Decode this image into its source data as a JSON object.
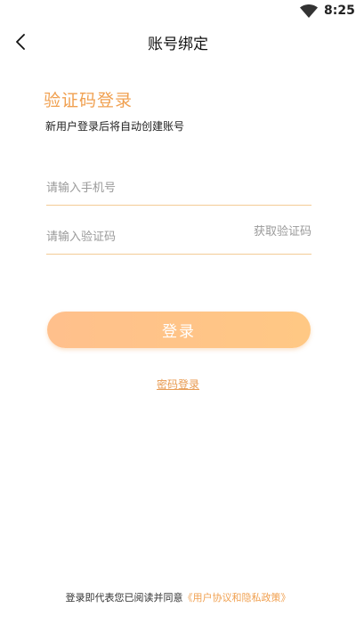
{
  "status_bar": {
    "time": "8:25",
    "wifi_icon": "wifi-icon"
  },
  "nav": {
    "title": "账号绑定",
    "back_icon": "chevron-left-icon"
  },
  "login": {
    "heading": "验证码登录",
    "subtitle": "新用户登录后将自动创建账号",
    "phone": {
      "value": "",
      "placeholder": "请输入手机号"
    },
    "code": {
      "value": "",
      "placeholder": "请输入验证码",
      "get_code_label": "获取验证码"
    },
    "submit_label": "登录",
    "password_login_label": "密码登录"
  },
  "agreement": {
    "prefix": "登录即代表您已阅读并同意",
    "link_label": "《用户协议和隐私政策》"
  },
  "colors": {
    "accent": "#F0A050",
    "button_start": "#FFC08C",
    "button_end": "#FFC884",
    "underline": "#F3CB96"
  }
}
